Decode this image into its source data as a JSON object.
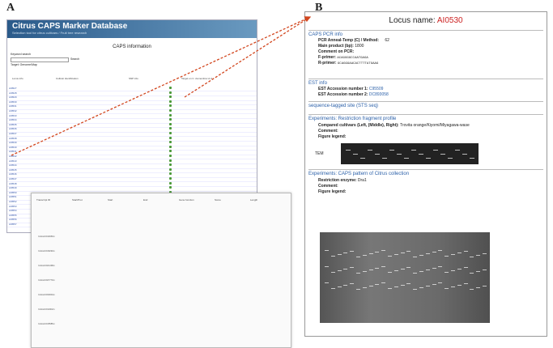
{
  "panel_a_letter": "A",
  "panel_b_letter": "B",
  "db": {
    "title": "Citrus CAPS Marker Database",
    "subtitle": "Selection tool for citrus cultivars / Fruit tree research",
    "caps_info": "CAPS information",
    "keyword_label": "Keyword search",
    "search_btn": "Search",
    "target_label": "Target: Genome/Map",
    "col_locus": "Locus info",
    "col_cultivar": "Cultivar identification",
    "col_snp": "SNP info",
    "col_target": "Target on C. clementina v1.0",
    "loci": [
      "AI0527",
      "AI0528",
      "AI0529",
      "AI0530",
      "AI0531",
      "AI0532",
      "AI0533",
      "AI0534",
      "AI0535",
      "AI0536",
      "AI0537",
      "AI0538",
      "AI0539",
      "AI0540",
      "AI0541",
      "AI0542",
      "AI0543",
      "AI0544",
      "AI0545",
      "AI0546",
      "AI0547",
      "AI0548",
      "AI0549",
      "AI0550",
      "AI0551",
      "AI0552",
      "AI0553",
      "AI0554",
      "AI0555",
      "AI0556",
      "AI0557"
    ]
  },
  "zoom": {
    "headers": [
      "Transcript ID",
      "Start/Prot",
      "Start",
      "End",
      "Gene function",
      "Score",
      "Length"
    ],
    "rows": [
      "Ciclev10014950m",
      "Ciclev10016293m",
      "Ciclev10021438m",
      "Ciclev10027770m",
      "Ciclev10030004m",
      "Ciclev10011902m",
      "Ciclev10015585m"
    ]
  },
  "locus": {
    "label": "Locus name:",
    "name": "AI0530",
    "pcr_heading": "CAPS PCR info",
    "pcr_temp_label": "PCR Anneal-Temp (C) / Method:",
    "pcr_temp": "62",
    "product_label": "Main product (bp):",
    "product": "1800",
    "comment_label": "Comment on PCR:",
    "fprimer_label": "F-primer:",
    "fprimer": "ACAGGGGCCAATGAGA",
    "rprimer_label": "R-primer:",
    "rprimer": "GCAGGGAACACTTTTATGAAG",
    "est_heading": "EST info",
    "est1_label": "EST Accession number 1:",
    "est1": "C95509",
    "est2_label": "EST Accession number 2:",
    "est2": "DC893058",
    "sts_link": "sequence-tagged site (STS seq)",
    "rfp_heading": "Experiments: Restriction fragment profile",
    "compared_label": "Compared cultivars (Left, (Middle), Right):",
    "compared": "Trovita orange/Kiyomi/Miyagawa-wase",
    "comment2_label": "Comment:",
    "legend_label": "Figure legend:",
    "tem_label": "TEM",
    "caps_heading": "Experiments: CAPS pattern of Citrus collection",
    "enzyme_label": "Restriction enzyme:",
    "enzyme": "Dra1",
    "comment3_label": "Comment:",
    "legend2_label": "Figure legend:"
  }
}
